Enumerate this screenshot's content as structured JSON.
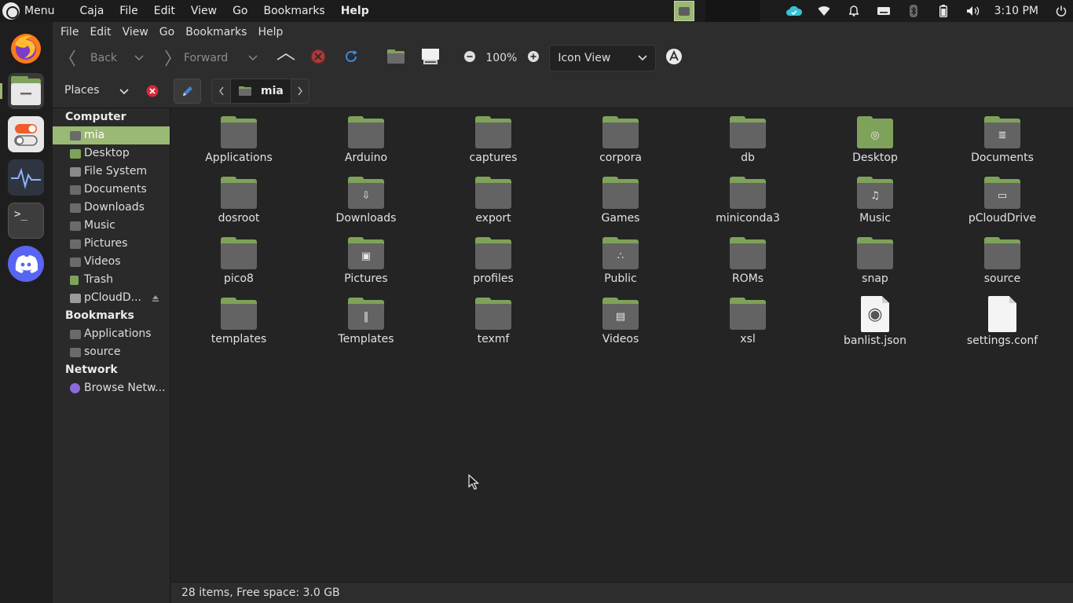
{
  "top_panel": {
    "menu_label": "Menu",
    "app_menu": [
      "Caja",
      "File",
      "Edit",
      "View",
      "Go",
      "Bookmarks",
      "Help"
    ],
    "clock": "3:10 PM"
  },
  "window": {
    "menubar": [
      "File",
      "Edit",
      "View",
      "Go",
      "Bookmarks",
      "Help"
    ],
    "toolbar": {
      "back_label": "Back",
      "forward_label": "Forward",
      "zoom_level": "100%",
      "view_mode": "Icon View"
    },
    "pathbar": {
      "places_label": "Places",
      "current_folder": "mia"
    },
    "sidebar": {
      "computer_heading": "Computer",
      "computer_items": [
        "mia",
        "Desktop",
        "File System",
        "Documents",
        "Downloads",
        "Music",
        "Pictures",
        "Videos",
        "Trash",
        "pCloudD..."
      ],
      "bookmarks_heading": "Bookmarks",
      "bookmark_items": [
        "Applications",
        "source"
      ],
      "network_heading": "Network",
      "network_items": [
        "Browse Netw..."
      ]
    },
    "files": [
      {
        "name": "Applications",
        "kind": "folder",
        "glyph": ""
      },
      {
        "name": "Arduino",
        "kind": "folder",
        "glyph": ""
      },
      {
        "name": "captures",
        "kind": "folder",
        "glyph": ""
      },
      {
        "name": "corpora",
        "kind": "folder",
        "glyph": ""
      },
      {
        "name": "db",
        "kind": "folder",
        "glyph": ""
      },
      {
        "name": "Desktop",
        "kind": "desktop",
        "glyph": "◎"
      },
      {
        "name": "Documents",
        "kind": "folder",
        "glyph": "≣"
      },
      {
        "name": "dosroot",
        "kind": "folder",
        "glyph": ""
      },
      {
        "name": "Downloads",
        "kind": "folder",
        "glyph": "⇩"
      },
      {
        "name": "export",
        "kind": "folder",
        "glyph": ""
      },
      {
        "name": "Games",
        "kind": "folder",
        "glyph": ""
      },
      {
        "name": "miniconda3",
        "kind": "folder",
        "glyph": ""
      },
      {
        "name": "Music",
        "kind": "folder",
        "glyph": "♫"
      },
      {
        "name": "pCloudDrive",
        "kind": "folder",
        "glyph": "▭"
      },
      {
        "name": "pico8",
        "kind": "folder",
        "glyph": ""
      },
      {
        "name": "Pictures",
        "kind": "folder",
        "glyph": "▣"
      },
      {
        "name": "profiles",
        "kind": "folder",
        "glyph": ""
      },
      {
        "name": "Public",
        "kind": "folder",
        "glyph": "∴"
      },
      {
        "name": "ROMs",
        "kind": "folder",
        "glyph": ""
      },
      {
        "name": "snap",
        "kind": "folder",
        "glyph": ""
      },
      {
        "name": "source",
        "kind": "folder",
        "glyph": ""
      },
      {
        "name": "templates",
        "kind": "folder",
        "glyph": ""
      },
      {
        "name": "Templates",
        "kind": "folder",
        "glyph": "‖"
      },
      {
        "name": "texmf",
        "kind": "folder",
        "glyph": ""
      },
      {
        "name": "Videos",
        "kind": "folder",
        "glyph": "▤"
      },
      {
        "name": "xsl",
        "kind": "folder",
        "glyph": ""
      },
      {
        "name": "banlist.json",
        "kind": "file",
        "glyph": "◉"
      },
      {
        "name": "settings.conf",
        "kind": "file",
        "glyph": ""
      }
    ],
    "status": "28 items, Free space: 3.0 GB"
  },
  "colors": {
    "accent": "#9ab974",
    "folder_tab": "#7fa25a",
    "folder_body": "#636363",
    "background": "#242424"
  }
}
